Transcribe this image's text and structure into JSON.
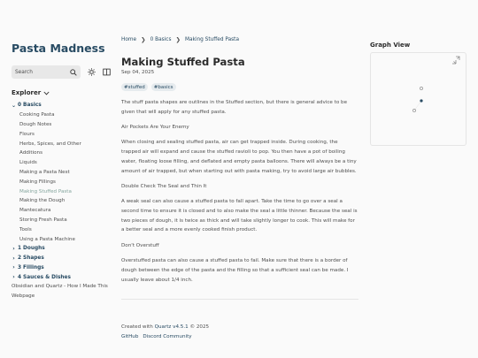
{
  "site": {
    "title": "Pasta Madness"
  },
  "search": {
    "placeholder": "Search"
  },
  "icons": {
    "search": "search-icon",
    "darkmode": "sun-icon",
    "reader": "book-icon",
    "expand": "expand-icon"
  },
  "explorer": {
    "title": "Explorer",
    "folders": [
      {
        "label": "0 Basics",
        "expanded": true,
        "items": [
          "Cooking Pasta",
          "Dough Notes",
          "Flours",
          "Herbs, Spices, and Other",
          "Additions",
          "Liquids",
          "Making a Pasta Nest",
          "Making Fillings",
          "Making Stuffed Pasta",
          "Making the Dough",
          "Mantecatura",
          "Storing Fresh Pasta",
          "Tools",
          "Using a Pasta Machine"
        ]
      },
      {
        "label": "1 Doughs",
        "expanded": false
      },
      {
        "label": "2 Shapes",
        "expanded": false
      },
      {
        "label": "3 Fillings",
        "expanded": false
      },
      {
        "label": "4 Sauces & Dishes",
        "expanded": false
      }
    ],
    "root_items": [
      "Obsidian and Quartz - How I Made This Webpage"
    ]
  },
  "breadcrumb": [
    "Home",
    "0 Basics",
    "Making Stuffed Pasta"
  ],
  "article": {
    "title": "Making Stuffed Pasta",
    "date": "Sep 04, 2025",
    "tags": [
      "#stuffed",
      "#basics"
    ],
    "paragraphs": [
      "The stuff pasta shapes are outlines in the Stuffed section, but there is general advice to be given that will apply for any stuffed pasta.",
      "Air Pockets Are Your Enemy",
      "When closing and sealing stuffed pasta, air can get trapped inside. During cooking, the trapped air will expand and cause the stuffed ravioli to pop. You then have a pot of boiling water, floating loose filling, and deflated and empty pasta balloons. There will always be a tiny amount of air trapped, but when starting out with pasta making, try to avoid large air bubbles.",
      "Double Check The Seal and Thin It",
      "A weak seal can also cause a stuffed pasta to fall apart. Take the time to go over a seal a second time to ensure it is closed and to also make the seal a little thinner. Because the seal is two pieces of dough, it is twice as thick and will take slightly longer to cook. This will make for a better seal and a more evenly cooked finish product.",
      "Don't Overstuff",
      "Overstuffed pasta can also cause a stuffed pasta to fail. Make sure that there is a border of dough between the edge of the pasta and the filling so that a sufficient seal can be made. I usually leave about 1/4 inch."
    ]
  },
  "footer": {
    "created_prefix": "Created with ",
    "quartz": "Quartz v4.5.1",
    "created_suffix": " © 2025",
    "links": [
      "GitHub",
      "Discord Community"
    ]
  },
  "graph": {
    "title": "Graph View",
    "nodes": 3
  },
  "colors": {
    "accent": "#284b63",
    "active": "#84a59d",
    "text": "#4e4e4e",
    "bg": "#fafafa"
  }
}
